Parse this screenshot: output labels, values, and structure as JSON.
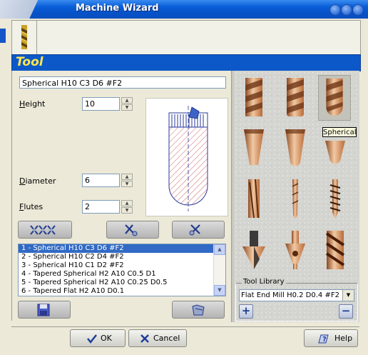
{
  "window": {
    "title": "Machine Wizard"
  },
  "section": {
    "title": "Tool"
  },
  "tool": {
    "name": "Spherical H10 C3 D6 #F2",
    "height_label_u": "H",
    "height_label_rest": "eight",
    "height_value": "10",
    "diameter_label_u": "D",
    "diameter_label_rest": "iameter",
    "diameter_value": "6",
    "flutes_label_u": "F",
    "flutes_label_rest": "lutes",
    "flutes_value": "2"
  },
  "tool_list": {
    "items": [
      "1 - Spherical H10 C3 D6 #F2",
      "2 - Spherical H10 C2 D4 #F2",
      "3 - Spherical H10 C1 D2 #F2",
      "4 - Tapered Spherical H2 A10 C0.5 D1",
      "5 - Tapered Spherical H2 A10 C0.25 D0.5",
      "6 - Tapered Flat H2 A10 D0.1"
    ],
    "selected_index": 0
  },
  "cutters": {
    "tooltip": "Spherical",
    "selected": "spherical",
    "grid": [
      [
        "flat-end",
        "bull-nose",
        "spherical"
      ],
      [
        "tapered-flat",
        "tapered-bull",
        "tapered-spherical"
      ],
      [
        "straight-flute",
        "engraver",
        "thread-mill"
      ],
      [
        "chamfer",
        "countersink",
        "helix"
      ]
    ]
  },
  "library": {
    "legend": "Tool Library",
    "selected": "Flat End Mill H0.2 D0.4 #F2"
  },
  "footer": {
    "ok_label": "OK",
    "cancel_label": "Cancel",
    "help_label": "Help"
  },
  "colors": {
    "title_bar": "#0A5FD8",
    "banner": "#0C58C8",
    "banner_text": "#FFE64A",
    "selection": "#316AC5",
    "copper": "#D9966A"
  }
}
